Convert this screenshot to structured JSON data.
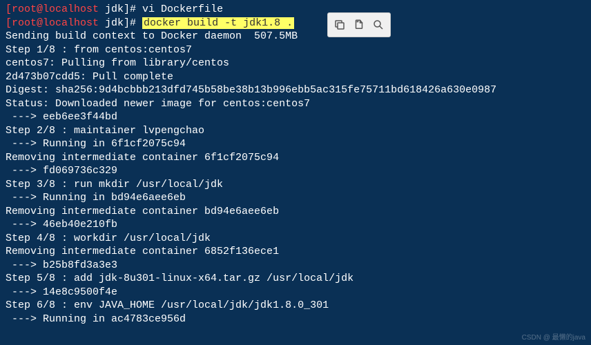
{
  "prompt1": {
    "user": "[root@localhost",
    "path": " jdk]# ",
    "cmd": "vi Dockerfile"
  },
  "prompt2": {
    "user": "[root@localhost",
    "path": " jdk]# ",
    "highlighted": "docker build -t jdk1.8 ."
  },
  "output": [
    "Sending build context to Docker daemon  507.5MB",
    "Step 1/8 : from centos:centos7",
    "centos7: Pulling from library/centos",
    "2d473b07cdd5: Pull complete",
    "Digest: sha256:9d4bcbbb213dfd745b58be38b13b996ebb5ac315fe75711bd618426a630e0987",
    "Status: Downloaded newer image for centos:centos7",
    " ---> eeb6ee3f44bd",
    "Step 2/8 : maintainer lvpengchao",
    " ---> Running in 6f1cf2075c94",
    "Removing intermediate container 6f1cf2075c94",
    " ---> fd069736c329",
    "Step 3/8 : run mkdir /usr/local/jdk",
    " ---> Running in bd94e6aee6eb",
    "Removing intermediate container bd94e6aee6eb",
    " ---> 46eb40e210fb",
    "Step 4/8 : workdir /usr/local/jdk",
    "Removing intermediate container 6852f136ece1",
    " ---> b25b8fd3a3e3",
    "Step 5/8 : add jdk-8u301-linux-x64.tar.gz /usr/local/jdk",
    " ---> 14e8c9500f4e",
    "Step 6/8 : env JAVA_HOME /usr/local/jdk/jdk1.8.0_301",
    " ---> Running in ac4783ce956d"
  ],
  "watermark": "CSDN @ 最懒的java"
}
